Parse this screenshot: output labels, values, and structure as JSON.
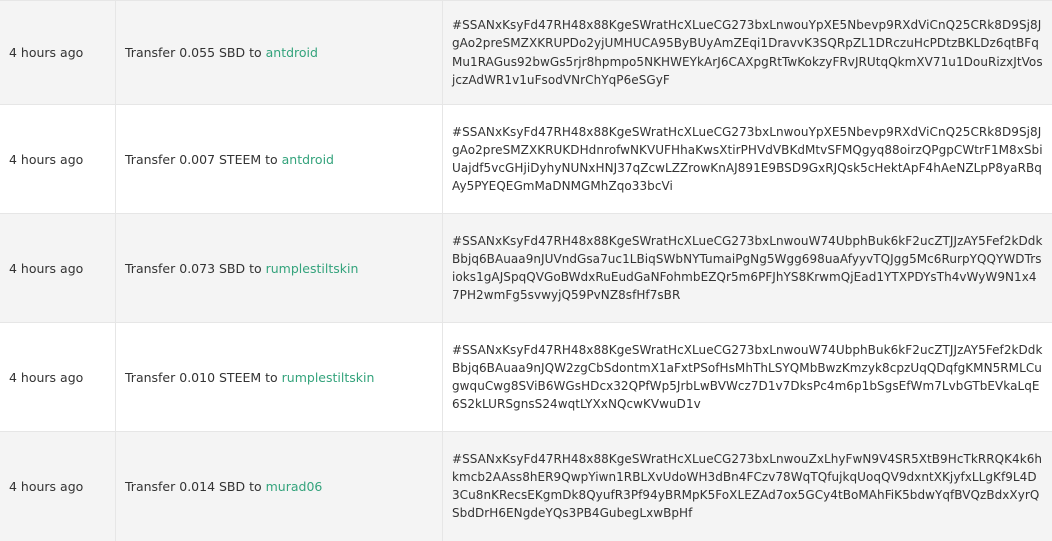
{
  "rows": [
    {
      "time": "4 hours ago",
      "op_prefix": "Transfer 0.055 SBD to ",
      "account": "antdroid",
      "memo": "#SSANxKsyFd47RH48x88KgeSWratHcXLueCG273bxLnwouYpXE5Nbevp9RXdViCnQ25CRk8D9Sj8JgAo2preSMZXKRUPDo2yjUMHUCA95ByBUyAmZEqi1DravvK3SQRpZL1DRczuHcPDtzBKLDz6qtBFqMu1RAGus92bwGs5rjr8hpmpo5NKHWEYkArJ6CAXpgRtTwKokzyFRvJRUtqQkmXV71u1DouRizxJtVosjczAdWR1v1uFsodVNrChYqP6eSGyF"
    },
    {
      "time": "4 hours ago",
      "op_prefix": "Transfer 0.007 STEEM to ",
      "account": "antdroid",
      "memo": "#SSANxKsyFd47RH48x88KgeSWratHcXLueCG273bxLnwouYpXE5Nbevp9RXdViCnQ25CRk8D9Sj8JgAo2preSMZXKRUKDHdnrofwNKVUFHhaKwsXtirPHVdVBKdMtvSFMQgyq88oirzQPgpCWtrF1M8xSbiUajdf5vcGHjiDyhyNUNxHNJ37qZcwLZZrowKnAJ891E9BSD9GxRJQsk5cHektApF4hAeNZLpP8yaRBqAy5PYEQEGmMaDNMGMhZqo33bcVi"
    },
    {
      "time": "4 hours ago",
      "op_prefix": "Transfer 0.073 SBD to ",
      "account": "rumplestiltskin",
      "memo": "#SSANxKsyFd47RH48x88KgeSWratHcXLueCG273bxLnwouW74UbphBuk6kF2ucZTJJzAY5Fef2kDdkBbjq6BAuaa9nJUVndGsa7uc1LBiqSWbNYTumaiPgNg5Wgg698uaAfyyvTQJgg5Mc6RurpYQQYWDTrsioks1gAJSpqQVGoBWdxRuEudGaNFohmbEZQr5m6PFJhYS8KrwmQjEad1YTXPDYsTh4vWyW9N1x47PH2wmFg5svwyjQ59PvNZ8sfHf7sBR"
    },
    {
      "time": "4 hours ago",
      "op_prefix": "Transfer 0.010 STEEM to ",
      "account": "rumplestiltskin",
      "memo": "#SSANxKsyFd47RH48x88KgeSWratHcXLueCG273bxLnwouW74UbphBuk6kF2ucZTJJzAY5Fef2kDdkBbjq6BAuaa9nJQW2zgCbSdontmX1aFxtPSofHsMhThLSYQMbBwzKmzyk8cpzUqQDqfgKMN5RMLCugwquCwg8SViB6WGsHDcx32QPfWp5JrbLwBVWcz7D1v7DksPc4m6p1bSgsEfWm7LvbGTbEVkaLqE6S2kLURSgnsS24wqtLYXxNQcwKVwuD1v"
    },
    {
      "time": "4 hours ago",
      "op_prefix": "Transfer 0.014 SBD to ",
      "account": "murad06",
      "memo": "#SSANxKsyFd47RH48x88KgeSWratHcXLueCG273bxLnwouZxLhyFwN9V4SR5XtB9HcTkRRQK4k6hkmcb2AAss8hER9QwpYiwn1RBLXvUdoWH3dBn4FCzv78WqTQfujkqUoqQV9dxntXKjyfxLLgKf9L4D3Cu8nKRecsEKgmDk8QyufR3Pf94yBRMpK5FoXLEZAd7ox5GCy4tBoMAhFiK5bdwYqfBVQzBdxXyrQSbdDrH6ENgdeYQs3PB4GubegLxwBpHf"
    }
  ]
}
